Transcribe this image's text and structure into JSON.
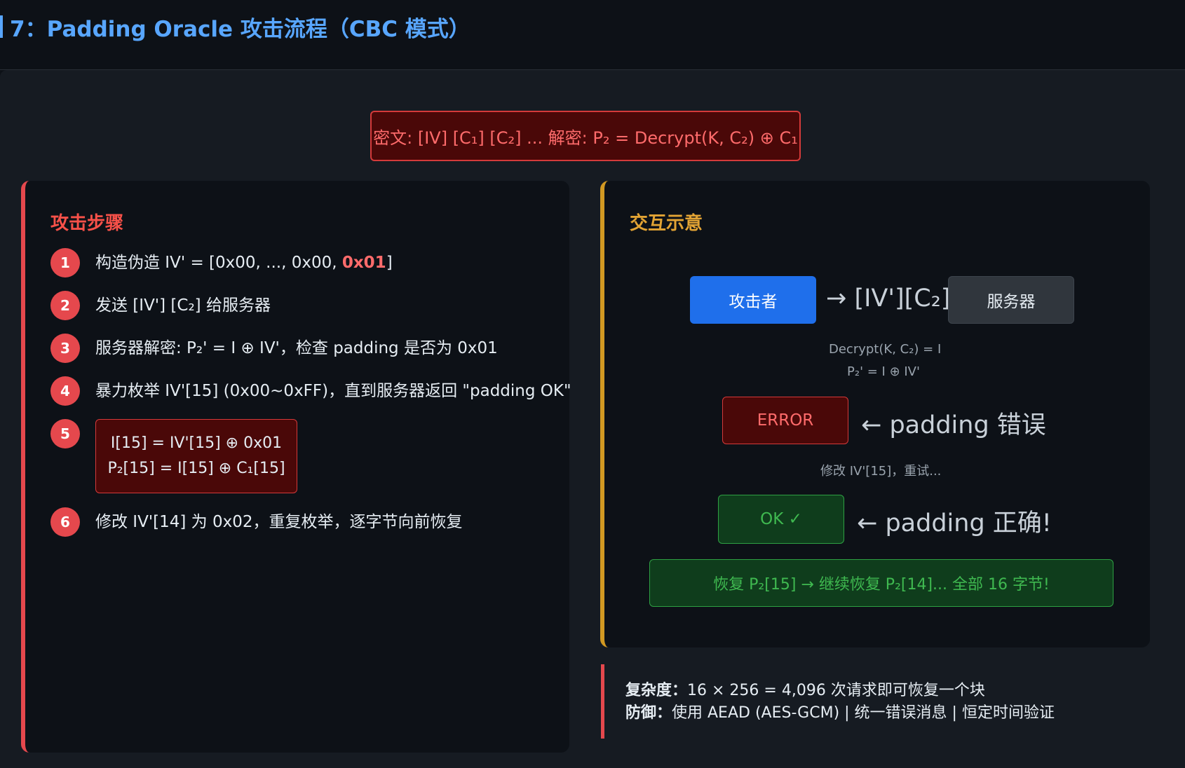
{
  "header": {
    "title": "7：Padding Oracle 攻击流程（CBC 模式）"
  },
  "cipher_box": "密文: [IV] [C₁] [C₂] ... 解密: P₂ = Decrypt(K, C₂) ⊕ C₁",
  "left_panel": {
    "title": "攻击步骤",
    "steps": [
      {
        "num": "1",
        "text_before": "构造伪造 IV' = [0x00, ..., 0x00, ",
        "text_highlight": "0x01",
        "text_after": "]"
      },
      {
        "num": "2",
        "text": "发送 [IV'] [C₂] 给服务器"
      },
      {
        "num": "3",
        "text": "服务器解密: P₂' = I ⊕ IV'，检查 padding 是否为 0x01"
      },
      {
        "num": "4",
        "text": "暴力枚举 IV'[15] (0x00~0xFF)，直到服务器返回 \"padding OK\""
      },
      {
        "num": "5",
        "formula_line1": "I[15] = IV'[15] ⊕ 0x01",
        "formula_line2": "P₂[15] = I[15] ⊕ C₁[15]"
      },
      {
        "num": "6",
        "text": "修改 IV'[14] 为 0x02，重复枚举，逐字节向前恢复"
      }
    ]
  },
  "right_panel": {
    "title": "交互示意",
    "attacker_label": "攻击者",
    "server_label": "服务器",
    "send_arrow": "→ [IV'][C₂]",
    "decrypt_line1": "Decrypt(K, C₂) = I",
    "decrypt_line2": "P₂' = I ⊕ IV'",
    "error_label": "ERROR",
    "error_arrow": "← padding 错误",
    "retry_text": "修改 IV'[15]，重试...",
    "ok_label": "OK ✓",
    "ok_arrow": "← padding 正确!",
    "recover_text": "恢复 P₂[15] → 继续恢复 P₂[14]... 全部 16 字节!"
  },
  "note": {
    "complexity_label": "复杂度：",
    "complexity_text": "16 × 256 = 4,096 次请求即可恢复一个块",
    "defense_label": "防御：",
    "defense_text": "使用 AEAD (AES-GCM) | 统一错误消息 | 恒定时间验证"
  },
  "colors": {
    "accent_blue": "#58a6ff",
    "attack_red": "#e5484d",
    "interaction_gold": "#d29922",
    "ok_green": "#3fb950"
  }
}
